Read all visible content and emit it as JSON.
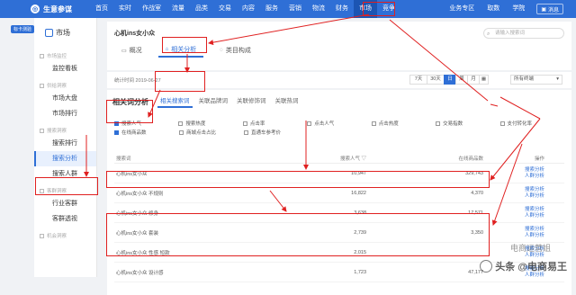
{
  "app": {
    "logo_text": "生意参谋",
    "badge": "标卡测验"
  },
  "nav": {
    "items": [
      "首页",
      "实时",
      "作战室",
      "流量",
      "品类",
      "交易",
      "内容",
      "服务",
      "营销",
      "物流",
      "财务",
      "市场",
      "竞争"
    ],
    "active": "市场",
    "right": [
      "业务专区",
      "取数",
      "学院"
    ],
    "message": "消息"
  },
  "sidebar": {
    "title": "市场",
    "groups": [
      {
        "name": "市场监控",
        "items": [
          "监控看板"
        ]
      },
      {
        "name": "供给洞察",
        "items": [
          "市场大盘",
          "市场排行"
        ]
      },
      {
        "name": "搜索洞察",
        "items": [
          "搜索排行",
          "搜索分析",
          "搜索人群"
        ]
      },
      {
        "name": "客群洞察",
        "items": [
          "行业客群",
          "客群透视"
        ]
      },
      {
        "name": "机会洞察",
        "items": []
      }
    ],
    "active_item": "搜索分析"
  },
  "header": {
    "shop_name": "心机ins女小众",
    "search_placeholder": "请输入搜索词",
    "tabs": [
      "概况",
      "相关分析",
      "类目构成"
    ],
    "active_tab": "相关分析"
  },
  "filter": {
    "stat_time": "统计时间 2019-06-27",
    "periods": [
      "7天",
      "30天",
      "日",
      "周",
      "月"
    ],
    "active_period": "日",
    "terminal": "所有终端"
  },
  "section": {
    "title": "相关词分析",
    "sub_tabs": [
      "相关搜索词",
      "关联品牌词",
      "关联修饰词",
      "关联热词"
    ],
    "active_sub_tab": "相关搜索词"
  },
  "options": {
    "row1": [
      {
        "label": "搜索人气",
        "checked": true
      },
      {
        "label": "搜索热度",
        "checked": false
      },
      {
        "label": "点击率",
        "checked": false
      },
      {
        "label": "点击人气",
        "checked": false
      },
      {
        "label": "点击热度",
        "checked": false
      },
      {
        "label": "交易指数",
        "checked": false
      },
      {
        "label": "支付转化率",
        "checked": false
      }
    ],
    "row2": [
      {
        "label": "在线商品数",
        "checked": true
      },
      {
        "label": "商城点击占比",
        "checked": false
      },
      {
        "label": "直通车参考价",
        "checked": false
      }
    ]
  },
  "table": {
    "headers": [
      "搜索词",
      "搜索人气 ▽",
      "在线商品数",
      "操作"
    ],
    "rows": [
      {
        "word": "心机ins女小众",
        "pop": "10,947",
        "count": "329,743"
      },
      {
        "word": "心机ins女小众 不规则",
        "pop": "16,822",
        "count": "4,370"
      },
      {
        "word": "心机ins女小众 修身",
        "pop": "3,638",
        "count": "17,571"
      },
      {
        "word": "心机ins女小众 套装",
        "pop": "2,739",
        "count": "3,350"
      },
      {
        "word": "心机ins女小众 性感 短款",
        "pop": "2,015",
        "count": ""
      },
      {
        "word": "心机ins女小众 设计感",
        "pop": "1,723",
        "count": "47,177"
      }
    ],
    "actions": [
      "搜索分析",
      "人群分析"
    ]
  },
  "watermark": {
    "line1": "电商运营姐",
    "line2": "头条 @电商易王"
  }
}
